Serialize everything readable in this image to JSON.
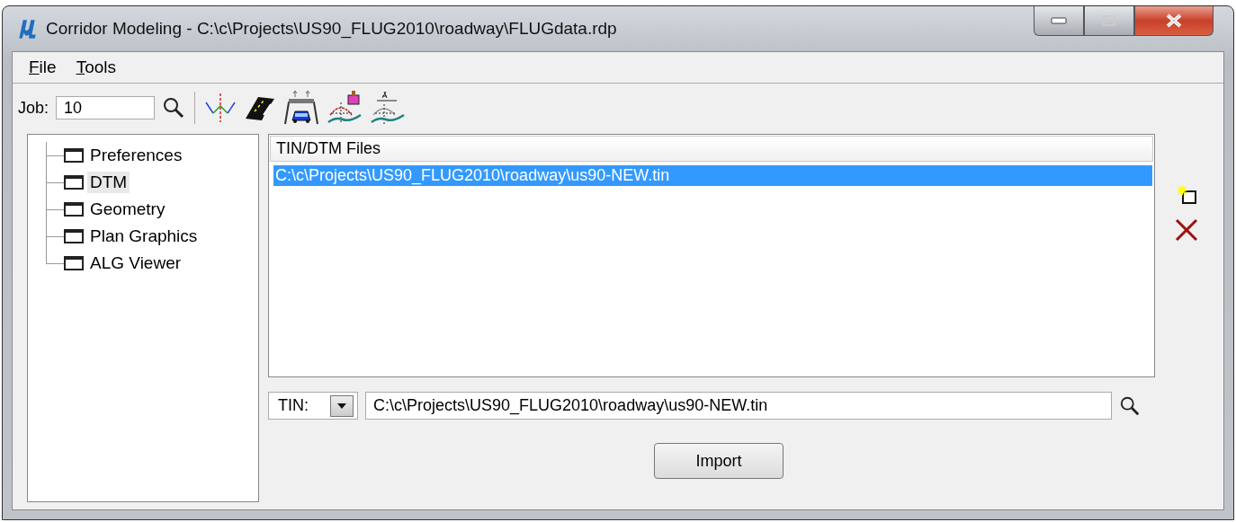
{
  "window": {
    "title": "Corridor Modeling - C:\\c\\Projects\\US90_FLUG2010\\roadway\\FLUGdata.rdp"
  },
  "menu": [
    {
      "access_key": "F",
      "label_rest": "ile"
    },
    {
      "access_key": "T",
      "label_rest": "ools"
    }
  ],
  "job": {
    "label": "Job:",
    "value": "10"
  },
  "tree": [
    {
      "label": "Preferences",
      "selected": false
    },
    {
      "label": "DTM",
      "selected": true
    },
    {
      "label": "Geometry",
      "selected": false
    },
    {
      "label": "Plan Graphics",
      "selected": false
    },
    {
      "label": "ALG Viewer",
      "selected": false
    }
  ],
  "list": {
    "columns": [
      "TIN/DTM Files"
    ],
    "rows": [
      {
        "text": "C:\\c\\Projects\\US90_FLUG2010\\roadway\\us90-NEW.tin",
        "selected": true
      }
    ]
  },
  "type_select": {
    "value": "TIN:"
  },
  "path": {
    "value": "C:\\c\\Projects\\US90_FLUG2010\\roadway\\us90-NEW.tin"
  },
  "buttons": [
    "Import"
  ]
}
